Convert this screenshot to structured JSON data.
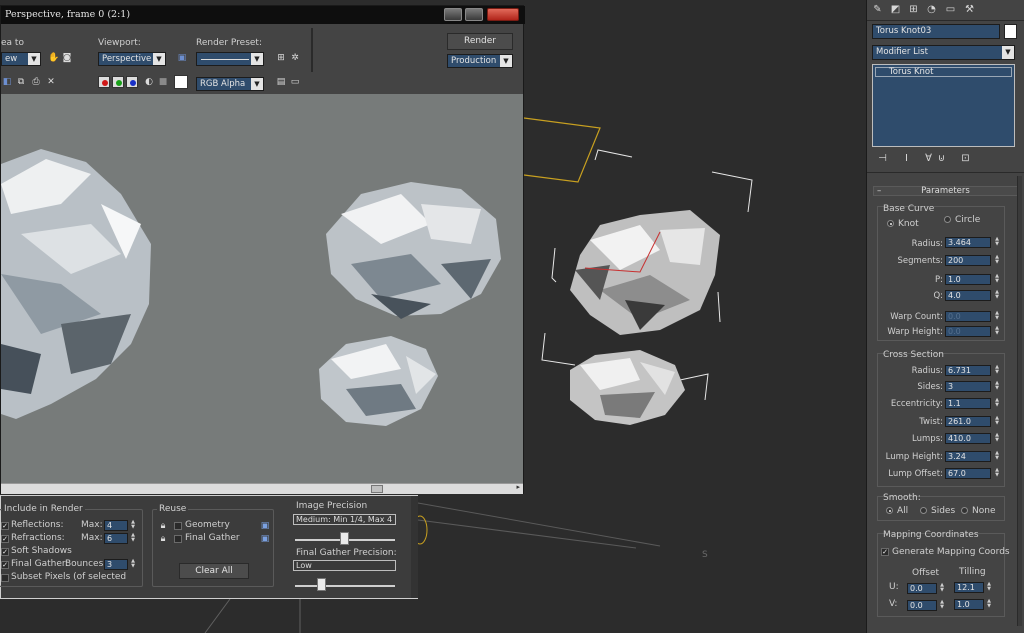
{
  "render_window": {
    "title": "Perspective, frame 0 (2:1)",
    "area_to_render_label": "ea to",
    "area_value": "ew",
    "viewport_label": "Viewport:",
    "viewport_value": "Perspective",
    "render_preset_label": "Render Preset:",
    "render_preset_value": "",
    "render_button": "Render",
    "production_value": "Production",
    "channel_value": "RGB Alpha"
  },
  "render_settings": {
    "include_group_title": "Include in Render",
    "reflections_label": "Reflections:",
    "refractions_label": "Refractions:",
    "soft_shadows_label": "Soft Shadows",
    "final_gather_label": "Final Gather:",
    "subset_label": "Subset Pixels (of selected",
    "max_label": "Max:",
    "bounces_label": "Bounces:",
    "reflections_max": "4",
    "refractions_max": "6",
    "bounces_value": "3",
    "reuse_group_title": "Reuse",
    "geometry_label": "Geometry",
    "final_gather_reuse_label": "Final Gather",
    "clear_all_button": "Clear All",
    "image_precision_label": "Image Precision",
    "image_precision_value": "Medium: Min 1/4, Max 4",
    "fg_precision_label": "Final Gather Precision:",
    "fg_precision_value": "Low"
  },
  "command_panel": {
    "object_name": "Torus Knot03",
    "object_color": "#ffffff",
    "modifier_list": "Modifier List",
    "stack_item": "Torus Knot",
    "parameters_title": "Parameters",
    "base_curve": {
      "title": "Base Curve",
      "knot_label": "Knot",
      "circle_label": "Circle",
      "radius_label": "Radius:",
      "radius": "3.464",
      "segments_label": "Segments:",
      "segments": "200",
      "p_label": "P:",
      "p": "1.0",
      "q_label": "Q:",
      "q": "4.0",
      "warp_count_label": "Warp Count:",
      "warp_count": "0.0",
      "warp_height_label": "Warp Height:",
      "warp_height": "0.0"
    },
    "cross_section": {
      "title": "Cross Section",
      "radius_label": "Radius:",
      "radius": "6.731",
      "sides_label": "Sides:",
      "sides": "3",
      "eccentricity_label": "Eccentricity:",
      "eccentricity": "1.1",
      "twist_label": "Twist:",
      "twist": "261.0",
      "lumps_label": "Lumps:",
      "lumps": "410.0",
      "lump_height_label": "Lump Height:",
      "lump_height": "3.24",
      "lump_offset_label": "Lump Offset:",
      "lump_offset": "67.0"
    },
    "smooth": {
      "title": "Smooth:",
      "all_label": "All",
      "sides_label": "Sides",
      "none_label": "None"
    },
    "mapping": {
      "title": "Mapping Coordinates",
      "generate_label": "Generate Mapping Coords",
      "offset_label": "Offset",
      "tiling_label": "Tilling",
      "u_label": "U:",
      "v_label": "V:",
      "u_offset": "0.0",
      "u_tiling": "12.1",
      "v_offset": "0.0",
      "v_tiling": "1.0"
    }
  },
  "viewport_marker": "S",
  "colors": {
    "viewport_bg": "#2c2c2c",
    "render_bg": "#777b7a",
    "spinner_bg": "#2f4c6c",
    "selection_yellow": "#c8a020"
  }
}
